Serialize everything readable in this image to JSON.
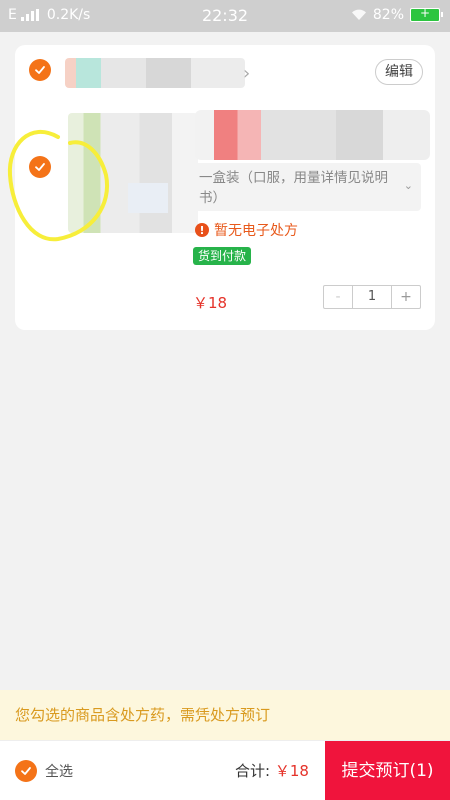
{
  "status_bar": {
    "network": "E",
    "speed": "0.2K/s",
    "time": "22:32",
    "battery": "82%"
  },
  "cart": {
    "edit_label": "编辑",
    "item": {
      "spec": "一盒装（口服，用量详情见说明书）",
      "rx_notice": "暂无电子处方",
      "payment_tag": "货到付款",
      "price": "￥18",
      "quantity": "1",
      "minus": "-",
      "plus": "+"
    }
  },
  "rx_banner": "您勾选的商品含处方药，需凭处方预订",
  "footer": {
    "select_all": "全选",
    "total_label": "合计:",
    "total_amount": "￥18",
    "submit_label": "提交预订(1)"
  },
  "colors": {
    "accent": "#f47318",
    "submit": "#f0143c",
    "price": "#e5332a",
    "cod": "#27b34a"
  }
}
